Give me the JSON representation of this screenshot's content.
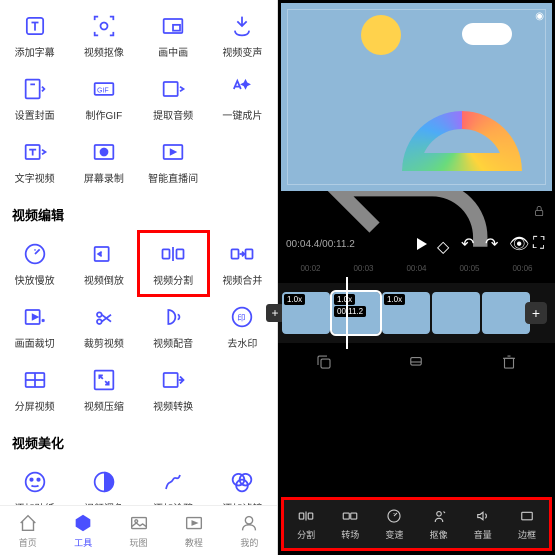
{
  "sections": {
    "top_tools": [
      {
        "label": "添加字幕",
        "icon": "text"
      },
      {
        "label": "视频抠像",
        "icon": "focus"
      },
      {
        "label": "画中画",
        "icon": "pip"
      },
      {
        "label": "视频变声",
        "icon": "voice"
      },
      {
        "label": "设置封面",
        "icon": "cover"
      },
      {
        "label": "制作GIF",
        "icon": "gif"
      },
      {
        "label": "提取音频",
        "icon": "extract"
      },
      {
        "label": "一键成片",
        "icon": "magic"
      },
      {
        "label": "文字视频",
        "icon": "text-video"
      },
      {
        "label": "屏幕录制",
        "icon": "record"
      },
      {
        "label": "智能直播间",
        "icon": "live"
      }
    ],
    "edit_title": "视频编辑",
    "edit_tools": [
      {
        "label": "快放慢放",
        "icon": "speed"
      },
      {
        "label": "视频倒放",
        "icon": "reverse"
      },
      {
        "label": "视频分割",
        "icon": "split",
        "highlight": true
      },
      {
        "label": "视频合并",
        "icon": "merge"
      },
      {
        "label": "画面裁切",
        "icon": "crop"
      },
      {
        "label": "裁剪视频",
        "icon": "trim"
      },
      {
        "label": "视频配音",
        "icon": "dub"
      },
      {
        "label": "去水印",
        "icon": "watermark"
      },
      {
        "label": "分屏视频",
        "icon": "split-screen"
      },
      {
        "label": "视频压缩",
        "icon": "compress"
      },
      {
        "label": "视频转换",
        "icon": "convert"
      }
    ],
    "beauty_title": "视频美化",
    "beauty_tools": [
      {
        "label": "添加贴纸",
        "icon": "sticker"
      },
      {
        "label": "视频调色",
        "icon": "color"
      },
      {
        "label": "添加涂鸦",
        "icon": "doodle"
      },
      {
        "label": "添加滤镜",
        "icon": "filter"
      }
    ]
  },
  "nav": [
    {
      "label": "首页",
      "icon": "home"
    },
    {
      "label": "工具",
      "icon": "tools",
      "active": true
    },
    {
      "label": "玩图",
      "icon": "image"
    },
    {
      "label": "教程",
      "icon": "tutorial"
    },
    {
      "label": "我的",
      "icon": "profile"
    }
  ],
  "editor": {
    "time_current": "00:04.4",
    "time_total": "00:11.2",
    "ticks": [
      "00:02",
      "00:03",
      "00:04",
      "00:05",
      "00:06"
    ],
    "clip_speed": "1.0x",
    "clip_duration": "00:11.2",
    "bottom_tools": [
      {
        "label": "分割",
        "icon": "split"
      },
      {
        "label": "转场",
        "icon": "transition"
      },
      {
        "label": "变速",
        "icon": "speed"
      },
      {
        "label": "抠像",
        "icon": "cutout"
      },
      {
        "label": "音量",
        "icon": "volume"
      },
      {
        "label": "边框",
        "icon": "border"
      }
    ]
  }
}
